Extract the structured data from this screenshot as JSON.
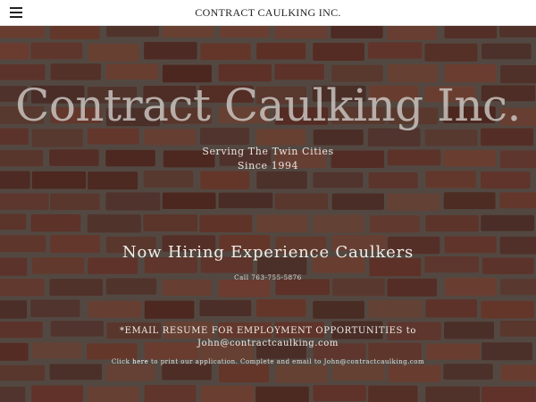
{
  "header": {
    "site_name": "CONTRACT CAULKING INC.",
    "menu_icon": "hamburger-menu-icon"
  },
  "hero": {
    "title": "Contract Caulking Inc.",
    "tagline_line1": "Serving The Twin Cities",
    "tagline_line2": "Since 1994",
    "hiring_heading": "Now Hiring Experience Caulkers",
    "phone_line": "Call 763-755-5876",
    "email_note": "*EMAIL RESUME FOR EMPLOYMENT OPPORTUNITIES to",
    "email_address": "John@contractcaulking.com",
    "print_prefix": "Click ",
    "print_link": "here",
    "print_suffix": " to print our application. Complete and email to John@contractcaulking.com"
  },
  "colors": {
    "header_bg": "#ffffff",
    "mortar": "#7a6c62",
    "brick_palette": [
      "#8a4636",
      "#7b3d2f",
      "#96503c",
      "#6e372a",
      "#a05a44",
      "#84503f",
      "#74463a",
      "#8f4a3a",
      "#6a4034",
      "#9a6048"
    ]
  }
}
